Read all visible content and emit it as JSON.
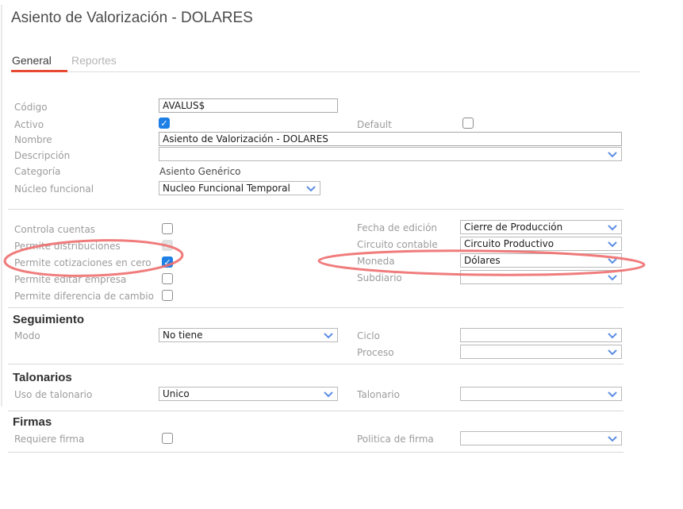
{
  "page": {
    "title": "Asiento de Valorización - DOLARES"
  },
  "tabs": {
    "general": "General",
    "reportes": "Reportes"
  },
  "colors": {
    "tab_accent": "#e64a33",
    "checkbox_checked": "#1e7fe6",
    "annotation_red": "#ee6e6e",
    "chevron_blue": "#5b8de4",
    "label_gray": "#9c9c9c"
  },
  "icons": {
    "chevron_down": "chevron-down-icon"
  },
  "form": {
    "codigo": {
      "label": "Código",
      "value": "AVALUS$"
    },
    "activo": {
      "label": "Activo",
      "checked": true
    },
    "default": {
      "label": "Default",
      "checked": false
    },
    "nombre": {
      "label": "Nombre",
      "value": "Asiento de Valorización - DOLARES"
    },
    "descripcion": {
      "label": "Descripción",
      "value": ""
    },
    "categoria": {
      "label": "Categoría",
      "value": "Asiento Genérico"
    },
    "nucleo_funcional": {
      "label": "Núcleo funcional",
      "value": "Nucleo Funcional Temporal"
    },
    "controla_cuentas": {
      "label": "Controla cuentas",
      "checked": false
    },
    "permite_distribuciones": {
      "label": "Permite distribuciones",
      "checked": true,
      "disabled": true
    },
    "permite_cotizaciones": {
      "label": "Permite cotizaciones en cero",
      "checked": true
    },
    "permite_editar_empresa": {
      "label": "Permite editar empresa",
      "checked": false
    },
    "permite_diferencia_cambio": {
      "label": "Permite diferencia de cambio",
      "checked": false
    },
    "fecha_edicion": {
      "label": "Fecha de edición",
      "value": "Cierre de Producción"
    },
    "circuito_contable": {
      "label": "Circuito contable",
      "value": "Circuito Productivo"
    },
    "moneda": {
      "label": "Moneda",
      "value": "Dólares"
    },
    "subdiario": {
      "label": "Subdiario",
      "value": ""
    },
    "seguimiento_heading": "Seguimiento",
    "modo": {
      "label": "Modo",
      "value": "No tiene"
    },
    "ciclo": {
      "label": "Ciclo",
      "value": ""
    },
    "proceso": {
      "label": "Proceso",
      "value": ""
    },
    "talonarios_heading": "Talonarios",
    "uso_talonario": {
      "label": "Uso de talonario",
      "value": "Unico"
    },
    "talonario": {
      "label": "Talonario",
      "value": ""
    },
    "firmas_heading": "Firmas",
    "requiere_firma": {
      "label": "Requiere firma",
      "checked": false
    },
    "politica_firma": {
      "label": "Politica de firma",
      "value": ""
    }
  },
  "annotations": {
    "ellipse_1_target": "permite-cotizaciones-row",
    "ellipse_2_target": "moneda-row"
  }
}
